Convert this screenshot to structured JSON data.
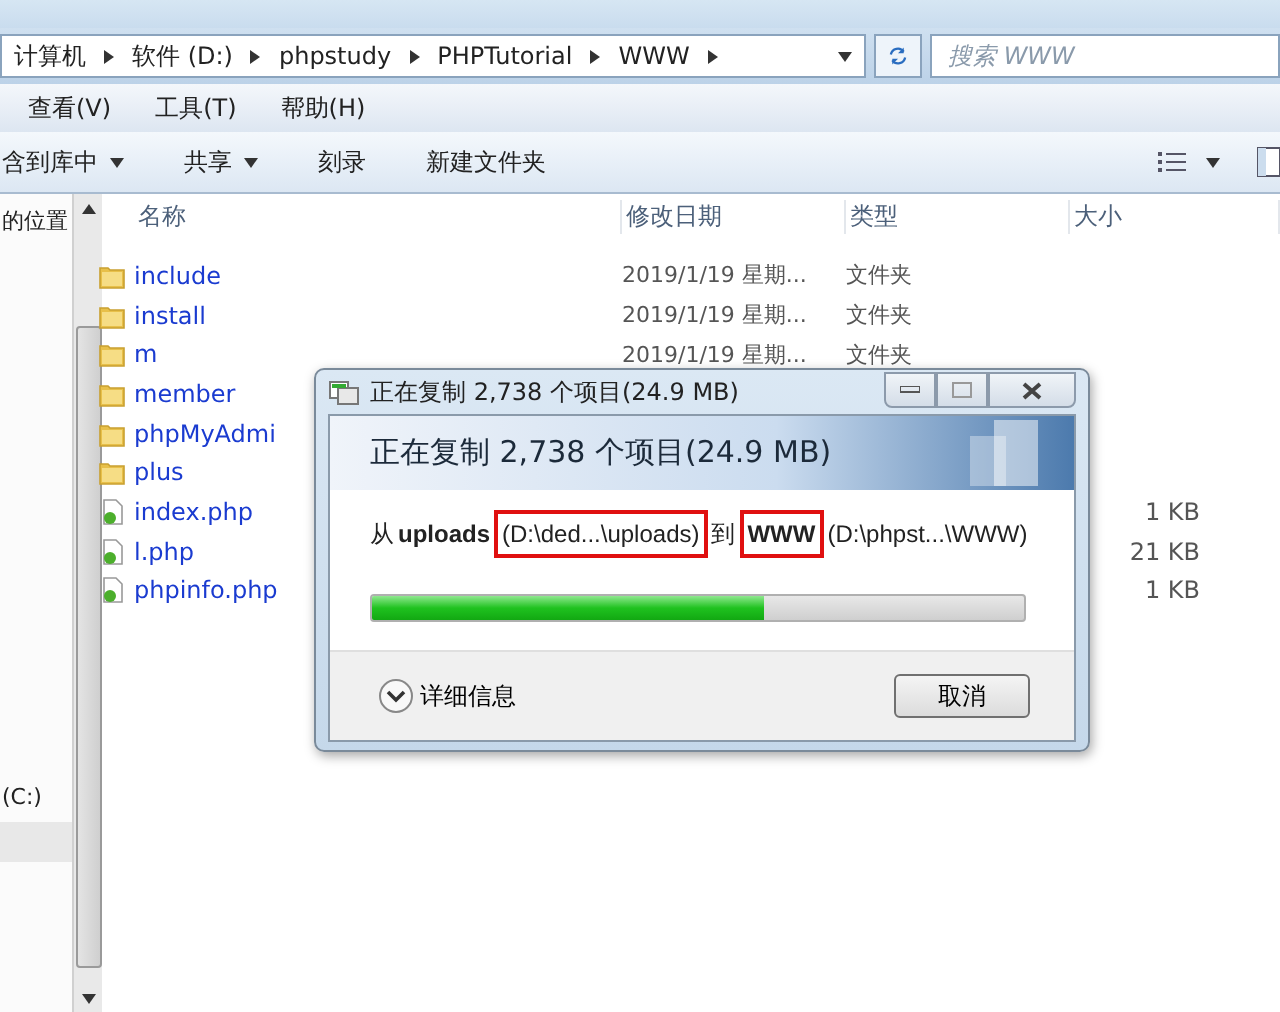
{
  "address_bar": {
    "breadcrumbs": [
      "计算机",
      "软件 (D:)",
      "phpstudy",
      "PHPTutorial",
      "WWW"
    ]
  },
  "search": {
    "placeholder": "搜索 WWW"
  },
  "menu": [
    "查看(V)",
    "工具(T)",
    "帮助(H)"
  ],
  "toolbar": [
    {
      "label": "含到库中",
      "dropdown": true
    },
    {
      "label": "共享",
      "dropdown": true
    },
    {
      "label": "刻录",
      "dropdown": false
    },
    {
      "label": "新建文件夹",
      "dropdown": false
    }
  ],
  "nav_pane": {
    "items": [
      {
        "label": "的位置",
        "selected": false
      },
      {
        "label": "(C:)",
        "selected": false
      },
      {
        "selected": true
      }
    ]
  },
  "columns": [
    "名称",
    "修改日期",
    "类型",
    "大小"
  ],
  "files": [
    {
      "kind": "folder",
      "name": "include",
      "date": "2019/1/19 星期...",
      "type": "文件夹"
    },
    {
      "kind": "folder",
      "name": "install",
      "date": "2019/1/19 星期...",
      "type": "文件夹"
    },
    {
      "kind": "folder",
      "name": "m",
      "date": "2019/1/19 星期...",
      "type": "文件夹"
    },
    {
      "kind": "folder",
      "name": "member"
    },
    {
      "kind": "folder",
      "name": "phpMyAdmi"
    },
    {
      "kind": "folder",
      "name": "plus"
    },
    {
      "kind": "php",
      "name": "index.php",
      "size": "1 KB"
    },
    {
      "kind": "php",
      "name": "l.php",
      "size": "21 KB"
    },
    {
      "kind": "php",
      "name": "phpinfo.php",
      "size": "1 KB"
    }
  ],
  "copy_dialog": {
    "title": "正在复制 2,738 个项目(24.9 MB)",
    "heading": "正在复制 2,738 个项目(24.9 MB)",
    "from_label": "从",
    "source_name": {
      "text": "uploads",
      "highlighted": false
    },
    "source_path": {
      "text": "(D:\\ded...\\uploads)",
      "highlighted": true
    },
    "to_label": "到",
    "dest_name": {
      "text": "WWW",
      "highlighted": true
    },
    "dest_path": {
      "text": "(D:\\phpst...\\WWW)",
      "highlighted": false
    },
    "progress": {
      "level": 0.6
    },
    "details": "详细信息",
    "cancel": "取消"
  }
}
